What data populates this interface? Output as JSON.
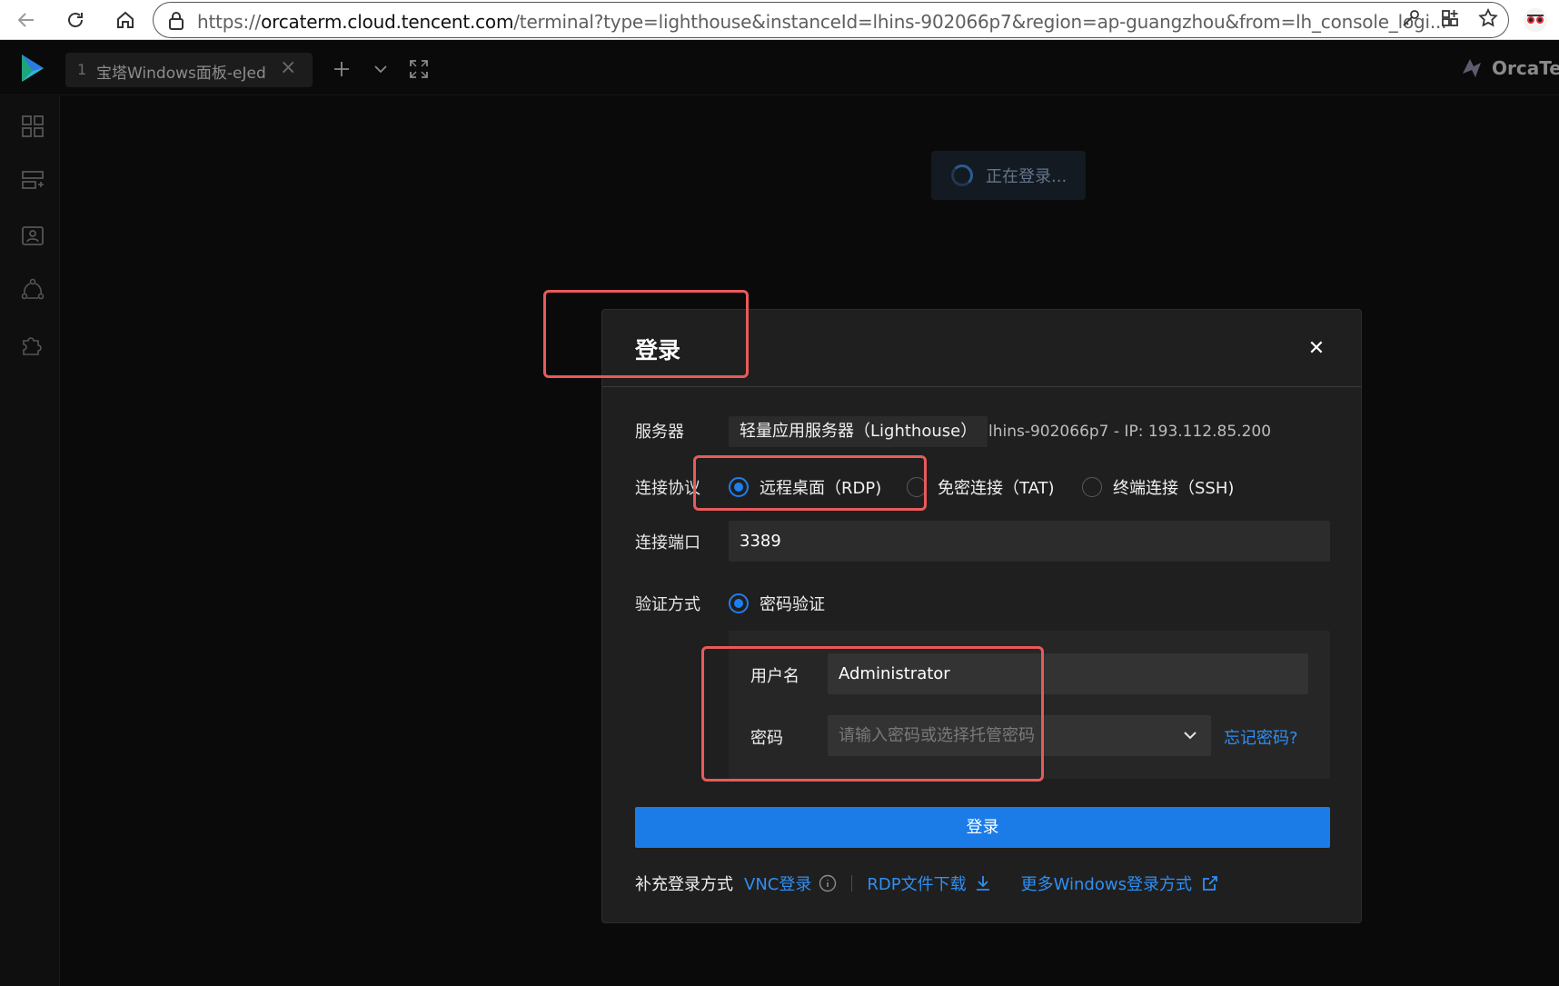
{
  "browser": {
    "url_prefix": "https://",
    "url_host": "orcaterm.cloud.tencent.com",
    "url_path": "/terminal?type=lighthouse&instanceId=lhins-902066p7&region=ap-guangzhou&from=lh_console_logi..."
  },
  "app": {
    "tab": {
      "index": "1",
      "title": "宝塔Windows面板-eJed"
    },
    "brand_name": "OrcaTerm",
    "status_text": "正在登录..."
  },
  "dialog": {
    "title": "登录",
    "server": {
      "label": "服务器",
      "tag": "轻量应用服务器（Lighthouse）",
      "info": "lhins-902066p7 - IP: 193.112.85.200"
    },
    "protocol": {
      "label": "连接协议",
      "options": [
        {
          "label": "远程桌面（RDP)",
          "checked": true
        },
        {
          "label": "免密连接（TAT)",
          "checked": false
        },
        {
          "label": "终端连接（SSH)",
          "checked": false
        }
      ]
    },
    "port": {
      "label": "连接端口",
      "value": "3389"
    },
    "auth": {
      "label": "验证方式",
      "option": "密码验证",
      "username_label": "用户名",
      "username_value": "Administrator",
      "password_label": "密码",
      "password_placeholder": "请输入密码或选择托管密码",
      "forgot": "忘记密码?"
    },
    "login_button": "登录",
    "extra": {
      "label": "补充登录方式",
      "vnc": "VNC登录",
      "rdp_download": "RDP文件下载",
      "more_windows": "更多Windows登录方式"
    }
  },
  "colors": {
    "accent": "#1b7ce8",
    "link": "#2f8ff5",
    "annotation": "#e85a5a"
  }
}
